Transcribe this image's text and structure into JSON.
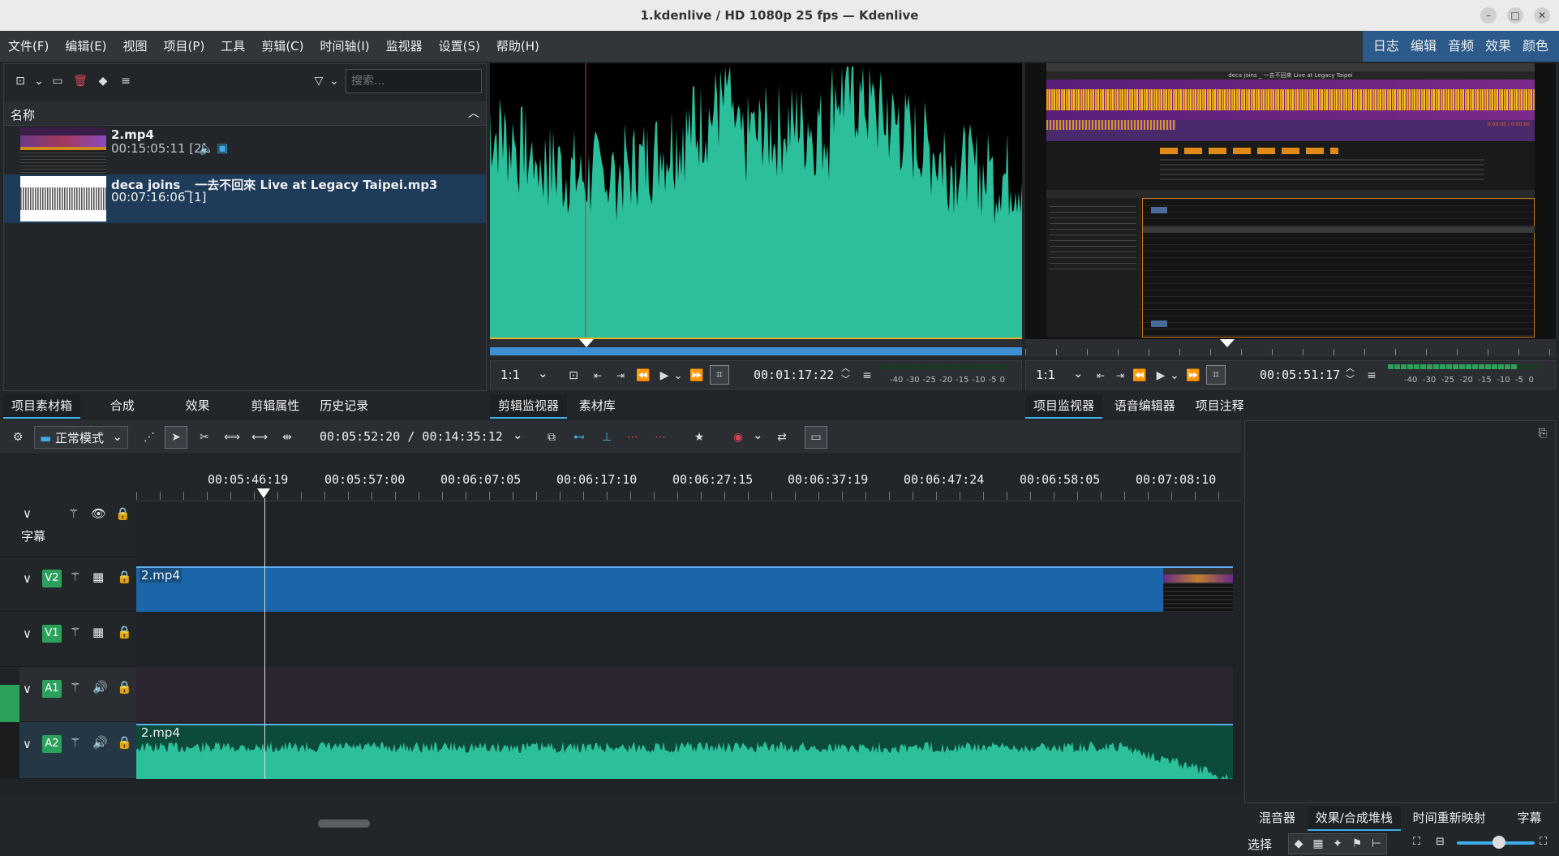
{
  "window": {
    "title": "1.kdenlive / HD 1080p 25 fps — Kdenlive",
    "controls": [
      "–",
      "□",
      "✕"
    ]
  },
  "menu": [
    "文件(F)",
    "编辑(E)",
    "视图",
    "项目(P)",
    "工具",
    "剪辑(C)",
    "时间轴(I)",
    "监视器",
    "设置(S)",
    "帮助(H)"
  ],
  "workspaces": [
    "日志",
    "编辑",
    "音频",
    "效果",
    "颜色"
  ],
  "bin": {
    "search_placeholder": "搜索...",
    "column_header": "名称",
    "clips": [
      {
        "name": "2.mp4",
        "info": "00:15:05:11 [2]"
      },
      {
        "name": "deca joins _ 一去不回來 Live at Legacy Taipei.mp3",
        "info": "00:07:16:06 [1]"
      }
    ],
    "tabs": [
      "项目素材箱",
      "合成",
      "效果",
      "剪辑属性",
      "历史记录"
    ]
  },
  "clip_monitor": {
    "zoom": "1:1",
    "timecode": "00:01:17:22",
    "tabs": [
      "剪辑监视器",
      "素材库"
    ],
    "vu_labels": [
      "-40",
      "-30",
      "-25",
      "-20",
      "-15",
      "-10",
      "-5",
      "0"
    ]
  },
  "project_monitor": {
    "zoom": "1:1",
    "timecode": "00:05:51:17",
    "tabs": [
      "项目监视器",
      "语音编辑器",
      "项目注释"
    ],
    "vu_labels": [
      "-40",
      "-30",
      "-25",
      "-20",
      "-15",
      "-10",
      "-5",
      "0"
    ],
    "screen_title": "deca joins _ 一去不回來 Live at Legacy Taipei",
    "screen_time": "0:00:00 / 0:00:00"
  },
  "timeline": {
    "mode": "正常模式",
    "position": "00:05:52:20 / 00:14:35:12",
    "ruler": [
      "00:05:46:19",
      "00:05:57:00",
      "00:06:07:05",
      "00:06:17:10",
      "00:06:27:15",
      "00:06:37:19",
      "00:06:47:24",
      "00:06:58:05",
      "00:07:08:10"
    ],
    "subtitle_track": "字幕",
    "tracks": [
      {
        "id": "V2",
        "clip": "2.mp4"
      },
      {
        "id": "V1",
        "clip": ""
      },
      {
        "id": "A1",
        "clip": ""
      },
      {
        "id": "A2",
        "clip": "2.mp4"
      }
    ]
  },
  "right_panel": {
    "tabs": [
      "混音器",
      "效果/合成堆栈",
      "时间重新映射",
      "字幕"
    ],
    "select_label": "选择"
  },
  "colors": {
    "accent": "#3daee9",
    "waveform": "#2bbf9c",
    "video_clip": "#1a66a8",
    "track_green": "#2ca15c"
  }
}
